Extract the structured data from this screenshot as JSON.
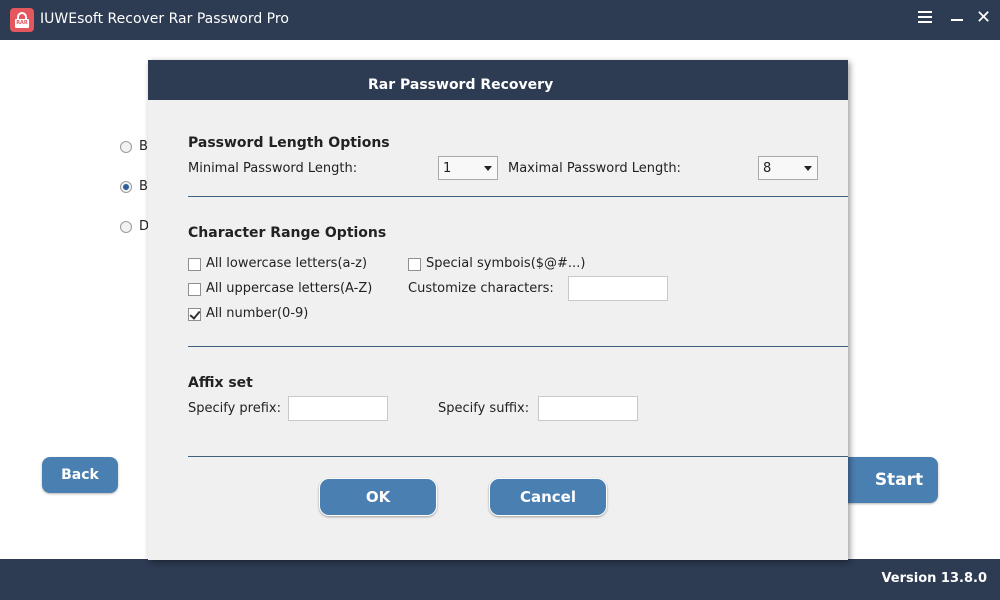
{
  "app": {
    "title": "IUWEsoft Recover Rar Password Pro",
    "icon_text": "RAR",
    "version": "Version 13.8.0"
  },
  "background": {
    "radios": [
      {
        "label": "B",
        "selected": false
      },
      {
        "label": "B",
        "selected": true
      },
      {
        "label": "D",
        "selected": false
      }
    ],
    "back_label": "Back",
    "start_label": "Start"
  },
  "dialog": {
    "title": "Rar Password Recovery",
    "password_length": {
      "title": "Password Length Options",
      "min_label": "Minimal Password Length:",
      "min_value": "1",
      "max_label": "Maximal Password Length:",
      "max_value": "8"
    },
    "character_range": {
      "title": "Character Range Options",
      "lowercase": {
        "label": "All lowercase letters(a-z)",
        "checked": false
      },
      "uppercase": {
        "label": "All uppercase letters(A-Z)",
        "checked": false
      },
      "number": {
        "label": "All number(0-9)",
        "checked": true
      },
      "special": {
        "label": "Special symbois($@#...)",
        "checked": false
      },
      "customize_label": "Customize characters:",
      "customize_value": ""
    },
    "affix": {
      "title": "Affix set",
      "prefix_label": "Specify prefix:",
      "prefix_value": "",
      "suffix_label": "Specify suffix:",
      "suffix_value": ""
    },
    "ok_label": "OK",
    "cancel_label": "Cancel"
  },
  "colors": {
    "header": "#2d3b53",
    "button": "#4a7fb2",
    "dialog_bg": "#f0f0f0"
  }
}
